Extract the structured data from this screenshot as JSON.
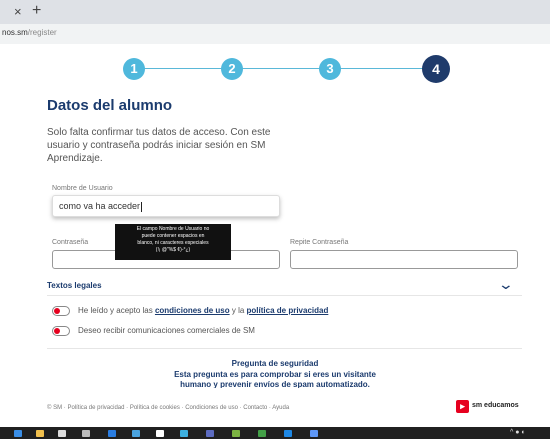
{
  "browser": {
    "close_glyph": "×",
    "new_tab_glyph": "+",
    "url_host": "nos.sm",
    "url_path": "/register"
  },
  "stepper": {
    "steps": [
      "1",
      "2",
      "3",
      "4"
    ],
    "active_step": 4,
    "colors": {
      "done": "#4fb8dc",
      "active": "#1f3b6b"
    }
  },
  "form": {
    "heading": "Datos del alumno",
    "intro": "Solo falta confirmar tus datos de acceso. Con este usuario y contraseña podrás iniciar sesión en SM Aprendizaje.",
    "username_label": "Nombre de Usuario",
    "username_value": "como va ha acceder",
    "tooltip_lines": [
      "El campo Nombre de Usuario no",
      "puede contener espacios en",
      "blanco, ni caracteres especiales",
      "(!¡ @\"%$ ¢)-°¿)"
    ],
    "password_label": "Contraseña",
    "password_value": "",
    "repeat_label": "Repite Contraseña",
    "repeat_value": ""
  },
  "legal": {
    "title": "Textos legales",
    "chevron_icon": "chevron-down-icon",
    "terms_prefix": "He leído y acepto las ",
    "terms_link": "condiciones de uso",
    "terms_middle": " y la ",
    "privacy_link": "política de privacidad",
    "marketing": "Deseo recibir comunicaciones comerciales de SM"
  },
  "security": {
    "title": "Pregunta de seguridad",
    "text": "Esta pregunta es para comprobar si eres un visitante humano y prevenir envíos de spam automatizado."
  },
  "footer": {
    "copyright": "© SM",
    "links": [
      "Política de privacidad",
      "Política de cookies",
      "Condiciones de uso",
      "Contacto",
      "Ayuda"
    ],
    "brand": "sm educamos",
    "brand_color": "#e6001f"
  },
  "taskbar": {
    "tray": "^ ● ◐"
  }
}
